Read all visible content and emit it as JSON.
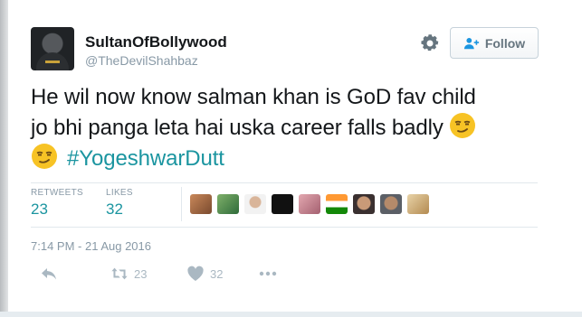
{
  "author": {
    "name": "SultanOfBollywood",
    "handle": "@TheDevilShahbaz"
  },
  "follow_label": "Follow",
  "tweet": {
    "line1": "He wil now know salman khan is GoD fav child",
    "line2": "jo bhi panga leta hai uska career falls badly",
    "hashtag": "#YogeshwarDutt"
  },
  "stats": {
    "retweets_label": "RETWEETS",
    "retweets_value": "23",
    "likes_label": "LIKES",
    "likes_value": "32"
  },
  "timestamp": "7:14 PM - 21 Aug 2016",
  "actions": {
    "retweet_count": "23",
    "like_count": "32"
  },
  "colors": {
    "link": "#1b95a0",
    "muted": "#8899a6",
    "icon": "#aab8c2"
  },
  "icons": [
    "gear-icon",
    "follow-person-icon",
    "smirk-emoji-icon",
    "reply-icon",
    "retweet-icon",
    "heart-icon",
    "more-icon"
  ]
}
